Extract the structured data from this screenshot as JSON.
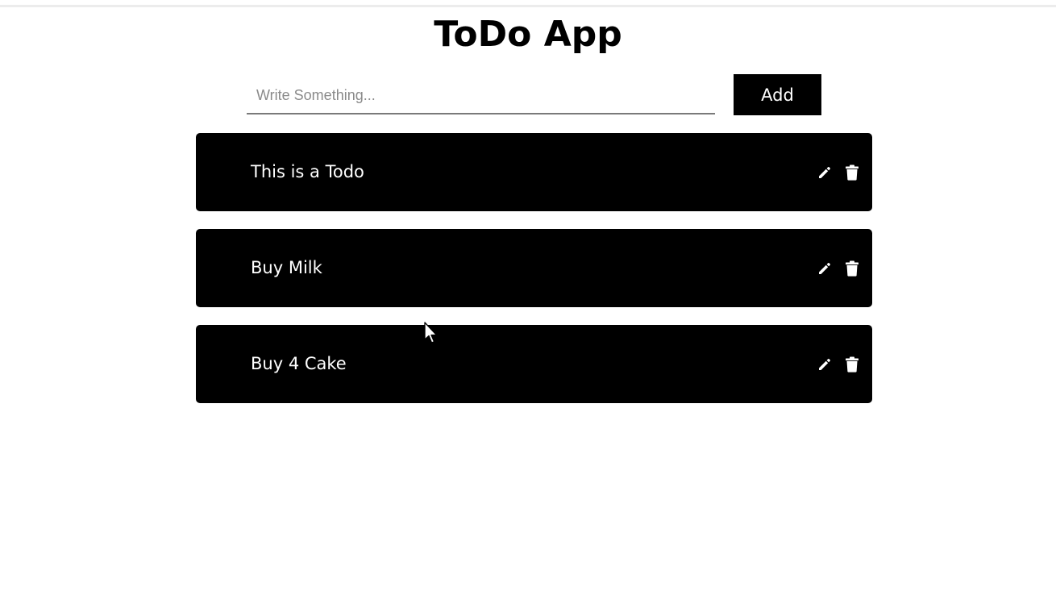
{
  "app": {
    "title": "ToDo App"
  },
  "input": {
    "placeholder": "Write Something...",
    "value": ""
  },
  "add_button": {
    "label": "Add"
  },
  "todos": [
    {
      "text": "This is a Todo",
      "edit_icon": "pencil-icon",
      "delete_icon": "trash-icon"
    },
    {
      "text": "Buy Milk",
      "edit_icon": "pencil-icon",
      "delete_icon": "trash-icon"
    },
    {
      "text": "Buy 4 Cake",
      "edit_icon": "pencil-icon",
      "delete_icon": "trash-icon"
    }
  ],
  "colors": {
    "background": "#ffffff",
    "item_background": "#000000",
    "item_text": "#ffffff",
    "button_background": "#000000",
    "button_text": "#ffffff",
    "input_underline": "#7a7a7a"
  }
}
